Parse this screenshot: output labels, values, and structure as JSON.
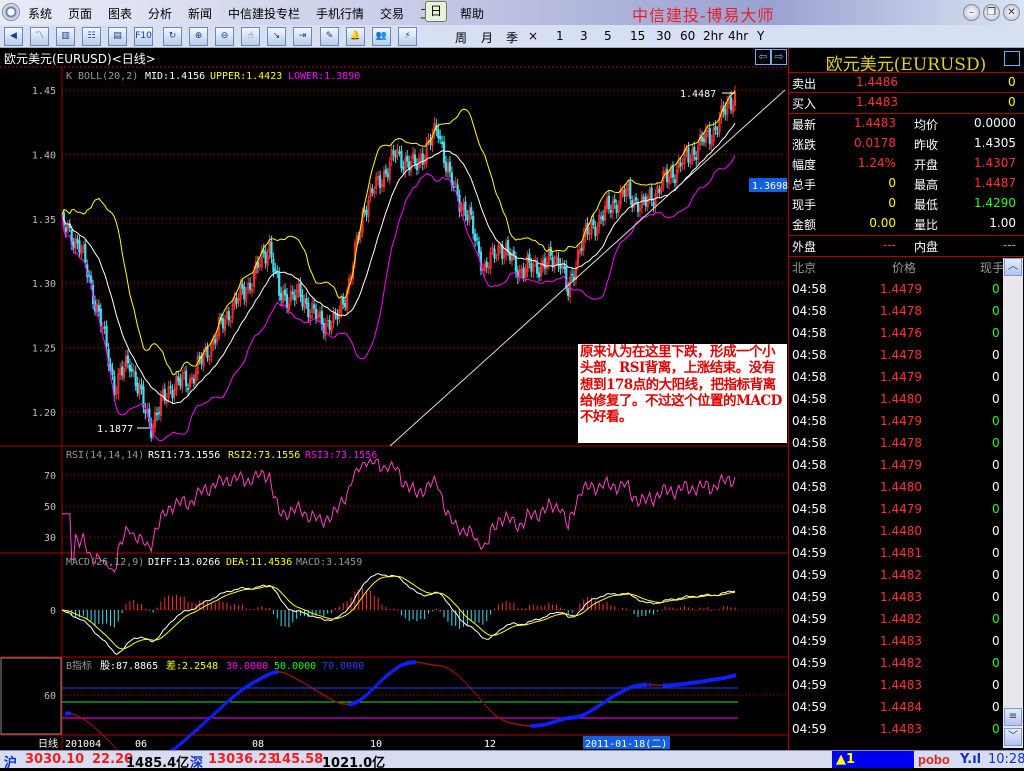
{
  "window": {
    "title": "中信建投-博易大师",
    "controls": [
      "minimize",
      "restore",
      "close"
    ]
  },
  "menu": [
    "系统",
    "页面",
    "图表",
    "分析",
    "新闻",
    "中信建投专栏",
    "手机行情",
    "交易",
    "工具",
    "帮助"
  ],
  "toolbar": {
    "icons": [
      "back-icon",
      "line-chart-icon",
      "kline-icon",
      "table-icon",
      "report-icon",
      "f10-icon",
      "refresh-icon",
      "zoom-in-icon",
      "zoom-out-icon",
      "pointer-icon",
      "export-icon",
      "import-icon",
      "draw-icon",
      "alert-bell-icon",
      "users-icon",
      "flash-icon"
    ],
    "f10_label": "F10",
    "periods": [
      "日",
      "周",
      "月",
      "季",
      "×",
      "1",
      "3",
      "5",
      "15",
      "30",
      "60",
      "2hr",
      "4hr",
      "Y"
    ],
    "active_period": "日"
  },
  "chart": {
    "title": "欧元美元(EURUSD)<日线>",
    "boll": {
      "label": "K  BOLL(20,2)",
      "mid": "MID:1.4156",
      "upper": "UPPER:1.4423",
      "lower": "LOWER:1.3890"
    },
    "price_ticks": [
      "1.45",
      "1.40",
      "1.35",
      "1.30",
      "1.25",
      "1.20"
    ],
    "high_label": "1.4487",
    "low_label": "1.1877",
    "cursor_price": "1.3698",
    "rsi": {
      "label": "RSI(14,14,14)",
      "rsi1": "RSI1:73.1556",
      "rsi2": "RSI2:73.1556",
      "rsi3": "RSI3:73.1556",
      "ticks": [
        "70",
        "50",
        "30"
      ]
    },
    "macd": {
      "label": "MACD(26,12,9)",
      "diff": "DIFF:13.0266",
      "dea": "DEA:11.4536",
      "macd": "MACD:3.1459",
      "ticks": [
        "0"
      ]
    },
    "b": {
      "label": "B指标",
      "gu": "股:87.8865",
      "cha": "差:2.2548",
      "l30": "30.0000",
      "l50": "50.0000",
      "l70": "70.0000",
      "ticks": [
        "60"
      ]
    },
    "period_label": "日线",
    "x_labels": [
      "201004",
      "06",
      "08",
      "10",
      "12"
    ],
    "cursor_date": "2011-01-18(二)",
    "annotation": "原来认为在这里下跌，形成一个小头部，RSI背离，上涨结束。没有想到178点的大阳线，把指标背离给修复了。不过这个位置的MACD不好看。",
    "colors": {
      "up": "#ff3030",
      "down": "#40e0f0",
      "mid": "#ffffff",
      "upper": "#ffff00",
      "lower": "#ff00ff",
      "grid": "#b00000"
    }
  },
  "chart_data": {
    "type": "candlestick",
    "series_name": "EURUSD",
    "close_keypoints": [
      [
        "2010-04-01",
        1.345
      ],
      [
        "2010-04-10",
        1.33
      ],
      [
        "2010-04-21",
        1.27
      ],
      [
        "2010-04-28",
        1.22
      ],
      [
        "2010-05-06",
        1.24
      ],
      [
        "2010-05-14",
        1.2
      ],
      [
        "2010-05-17",
        1.19
      ],
      [
        "2010-05-27",
        1.22
      ],
      [
        "2010-06-06",
        1.225
      ],
      [
        "2010-06-16",
        1.25
      ],
      [
        "2010-06-27",
        1.28
      ],
      [
        "2010-07-07",
        1.3
      ],
      [
        "2010-07-17",
        1.33
      ],
      [
        "2010-07-22",
        1.29
      ],
      [
        "2010-08-02",
        1.29
      ],
      [
        "2010-08-12",
        1.27
      ],
      [
        "2010-08-20",
        1.27
      ],
      [
        "2010-08-27",
        1.3
      ],
      [
        "2010-09-04",
        1.36
      ],
      [
        "2010-09-12",
        1.38
      ],
      [
        "2010-09-20",
        1.4
      ],
      [
        "2010-09-30",
        1.39
      ],
      [
        "2010-10-12",
        1.42
      ],
      [
        "2010-10-18",
        1.38
      ],
      [
        "2010-10-28",
        1.35
      ],
      [
        "2010-11-05",
        1.31
      ],
      [
        "2010-11-13",
        1.33
      ],
      [
        "2010-11-23",
        1.31
      ],
      [
        "2010-12-06",
        1.315
      ],
      [
        "2010-12-14",
        1.32
      ],
      [
        "2010-12-18",
        1.29
      ],
      [
        "2010-12-24",
        1.33
      ],
      [
        "2011-01-03",
        1.35
      ],
      [
        "2011-01-16",
        1.37
      ],
      [
        "2011-01-26",
        1.36
      ],
      [
        "2011-02-06",
        1.38
      ],
      [
        "2011-02-19",
        1.4
      ],
      [
        "2011-03-04",
        1.42
      ],
      [
        "2011-03-14",
        1.448
      ]
    ],
    "ylim": [
      1.18,
      1.46
    ],
    "high": 1.4487,
    "low": 1.1877
  },
  "quote": {
    "title": "欧元美元(EURUSD)",
    "sell": {
      "label": "卖出",
      "price": "1.4486",
      "vol": "0"
    },
    "buy": {
      "label": "买入",
      "price": "1.4483",
      "vol": "0"
    },
    "rows": [
      {
        "l1": "最新",
        "v1": "1.4483",
        "c1": "#ff3030",
        "l2": "均价",
        "v2": "0.0000",
        "c2": "#ffffff"
      },
      {
        "l1": "涨跌",
        "v1": "0.0178",
        "c1": "#ff3030",
        "l2": "昨收",
        "v2": "1.4305",
        "c2": "#ffffff"
      },
      {
        "l1": "幅度",
        "v1": "1.24%",
        "c1": "#ff3030",
        "l2": "开盘",
        "v2": "1.4307",
        "c2": "#ff3030"
      },
      {
        "l1": "总手",
        "v1": "0",
        "c1": "#ffff00",
        "l2": "最高",
        "v2": "1.4487",
        "c2": "#ff3030"
      },
      {
        "l1": "现手",
        "v1": "0",
        "c1": "#ffff00",
        "l2": "最低",
        "v2": "1.4290",
        "c2": "#20ff20"
      },
      {
        "l1": "金额",
        "v1": "0.00",
        "c1": "#ffff00",
        "l2": "量比",
        "v2": "1.00",
        "c2": "#ffffff"
      }
    ],
    "outer": {
      "label": "外盘",
      "value": "---"
    },
    "inner": {
      "label": "内盘",
      "value": "---"
    },
    "tick_header": {
      "time": "北京",
      "price": "价格",
      "vol": "现手"
    },
    "ticks": [
      {
        "t": "04:58",
        "p": "1.4479",
        "v": "0",
        "vc": "#20ff20"
      },
      {
        "t": "04:58",
        "p": "1.4478",
        "v": "0",
        "vc": "#20ff20"
      },
      {
        "t": "04:58",
        "p": "1.4476",
        "v": "0",
        "vc": "#20ff20"
      },
      {
        "t": "04:58",
        "p": "1.4478",
        "v": "0",
        "vc": "#ffffff"
      },
      {
        "t": "04:58",
        "p": "1.4479",
        "v": "0",
        "vc": "#ffffff"
      },
      {
        "t": "04:58",
        "p": "1.4480",
        "v": "0",
        "vc": "#ffffff"
      },
      {
        "t": "04:58",
        "p": "1.4479",
        "v": "0",
        "vc": "#20ff20"
      },
      {
        "t": "04:58",
        "p": "1.4478",
        "v": "0",
        "vc": "#20ff20"
      },
      {
        "t": "04:58",
        "p": "1.4479",
        "v": "0",
        "vc": "#ffffff"
      },
      {
        "t": "04:58",
        "p": "1.4480",
        "v": "0",
        "vc": "#ffffff"
      },
      {
        "t": "04:58",
        "p": "1.4479",
        "v": "0",
        "vc": "#20ff20"
      },
      {
        "t": "04:58",
        "p": "1.4480",
        "v": "0",
        "vc": "#ffffff"
      },
      {
        "t": "04:59",
        "p": "1.4481",
        "v": "0",
        "vc": "#ffffff"
      },
      {
        "t": "04:59",
        "p": "1.4482",
        "v": "0",
        "vc": "#ffffff"
      },
      {
        "t": "04:59",
        "p": "1.4483",
        "v": "0",
        "vc": "#ffffff"
      },
      {
        "t": "04:59",
        "p": "1.4482",
        "v": "0",
        "vc": "#20ff20"
      },
      {
        "t": "04:59",
        "p": "1.4483",
        "v": "0",
        "vc": "#ffffff"
      },
      {
        "t": "04:59",
        "p": "1.4482",
        "v": "0",
        "vc": "#20ff20"
      },
      {
        "t": "04:59",
        "p": "1.4483",
        "v": "0",
        "vc": "#ffffff"
      },
      {
        "t": "04:59",
        "p": "1.4484",
        "v": "0",
        "vc": "#ffffff"
      },
      {
        "t": "04:59",
        "p": "1.4483",
        "v": "0",
        "vc": "#20ff20"
      }
    ]
  },
  "status": {
    "sh_label": "沪",
    "sh_index": "3030.10",
    "sh_change": "22.20",
    "sh_amount": "1485.4亿",
    "sz_label": "深",
    "sz_index": "13036.23",
    "sz_change": "145.58",
    "sz_amount": "1021.0亿",
    "alert": "▲1",
    "brand": "pobo",
    "clock": "10:28"
  }
}
